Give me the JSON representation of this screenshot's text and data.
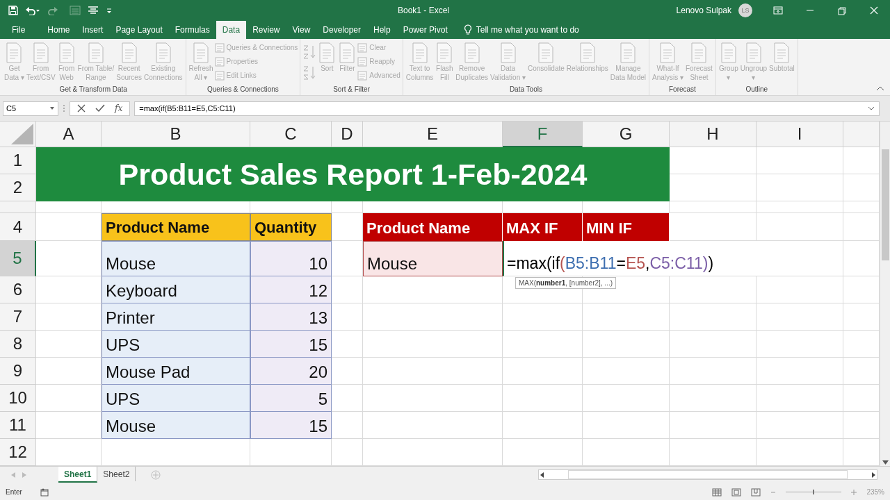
{
  "window": {
    "title": "Book1  -  Excel",
    "user": "Lenovo Sulpak",
    "avatar": "LS"
  },
  "tabs": [
    {
      "label": "File",
      "selected": false
    },
    {
      "label": "Home",
      "selected": false
    },
    {
      "label": "Insert",
      "selected": false
    },
    {
      "label": "Page Layout",
      "selected": false
    },
    {
      "label": "Formulas",
      "selected": false
    },
    {
      "label": "Data",
      "selected": true
    },
    {
      "label": "Review",
      "selected": false
    },
    {
      "label": "View",
      "selected": false
    },
    {
      "label": "Developer",
      "selected": false
    },
    {
      "label": "Help",
      "selected": false
    },
    {
      "label": "Power Pivot",
      "selected": false
    }
  ],
  "tell_me": "Tell me what you want to do",
  "ribbon": {
    "groups": [
      {
        "label": "Get & Transform Data",
        "commands": [
          {
            "kind": "large",
            "lines": [
              "Get",
              "Data ▾"
            ],
            "disabled": true
          },
          {
            "kind": "large",
            "lines": [
              "From",
              "Text/CSV"
            ],
            "disabled": true
          },
          {
            "kind": "large",
            "lines": [
              "From",
              "Web"
            ],
            "disabled": true
          },
          {
            "kind": "large",
            "lines": [
              "From Table/",
              "Range"
            ],
            "disabled": true
          },
          {
            "kind": "large",
            "lines": [
              "Recent",
              "Sources"
            ],
            "disabled": true
          },
          {
            "kind": "large",
            "lines": [
              "Existing",
              "Connections"
            ],
            "disabled": true
          }
        ]
      },
      {
        "label": "Queries & Connections",
        "commands": [
          {
            "kind": "large",
            "lines": [
              "Refresh",
              "All ▾"
            ],
            "disabled": true
          },
          {
            "kind": "small",
            "lines": [
              "Queries & Connections",
              "Properties",
              "Edit Links"
            ],
            "disabled": true
          }
        ]
      },
      {
        "label": "Sort & Filter",
        "commands": [
          {
            "kind": "sorticons",
            "disabled": true
          },
          {
            "kind": "large",
            "lines": [
              "Sort"
            ],
            "disabled": true
          },
          {
            "kind": "large",
            "lines": [
              "Filter"
            ],
            "disabled": true
          },
          {
            "kind": "small",
            "lines": [
              "Clear",
              "Reapply",
              "Advanced"
            ],
            "disabled": true
          }
        ]
      },
      {
        "label": "Data Tools",
        "commands": [
          {
            "kind": "large",
            "lines": [
              "Text to",
              "Columns"
            ],
            "disabled": true
          },
          {
            "kind": "large",
            "lines": [
              "Flash",
              "Fill"
            ],
            "disabled": true
          },
          {
            "kind": "large",
            "lines": [
              "Remove",
              "Duplicates"
            ],
            "disabled": true
          },
          {
            "kind": "large",
            "lines": [
              "Data",
              "Validation ▾"
            ],
            "disabled": true
          },
          {
            "kind": "large",
            "lines": [
              "Consolidate"
            ],
            "disabled": true
          },
          {
            "kind": "large",
            "lines": [
              "Relationships"
            ],
            "disabled": true
          },
          {
            "kind": "large",
            "lines": [
              "Manage",
              "Data Model"
            ],
            "disabled": true
          }
        ]
      },
      {
        "label": "Forecast",
        "commands": [
          {
            "kind": "large",
            "lines": [
              "What-If",
              "Analysis ▾"
            ],
            "disabled": true
          },
          {
            "kind": "large",
            "lines": [
              "Forecast",
              "Sheet"
            ],
            "disabled": true
          }
        ]
      },
      {
        "label": "Outline",
        "commands": [
          {
            "kind": "large",
            "lines": [
              "Group",
              "▾"
            ],
            "disabled": true
          },
          {
            "kind": "large",
            "lines": [
              "Ungroup",
              "▾"
            ],
            "disabled": true
          },
          {
            "kind": "large",
            "lines": [
              "Subtotal"
            ],
            "disabled": true
          }
        ]
      }
    ]
  },
  "formula_bar": {
    "name_box": "C5",
    "fx": "fx",
    "formula": "=max(if(B5:B11=E5,C5:C11)"
  },
  "columns": [
    {
      "label": "A",
      "selected": false
    },
    {
      "label": "B",
      "selected": false
    },
    {
      "label": "C",
      "selected": false
    },
    {
      "label": "D",
      "selected": false
    },
    {
      "label": "E",
      "selected": false
    },
    {
      "label": "F",
      "selected": true
    },
    {
      "label": "G",
      "selected": false
    },
    {
      "label": "H",
      "selected": false
    },
    {
      "label": "I",
      "selected": false
    }
  ],
  "rows": [
    {
      "kind": "normal",
      "label": "1",
      "selected": false
    },
    {
      "kind": "normal",
      "label": "2",
      "selected": false
    },
    {
      "kind": "short",
      "selected": false
    },
    {
      "kind": "normal",
      "label": "4",
      "selected": false
    },
    {
      "kind": "normal",
      "label": "5",
      "selected": true
    },
    {
      "kind": "normal",
      "label": "6",
      "selected": false
    },
    {
      "kind": "normal",
      "label": "7",
      "selected": false
    },
    {
      "kind": "normal",
      "label": "8",
      "selected": false
    },
    {
      "kind": "normal",
      "label": "9",
      "selected": false
    },
    {
      "kind": "normal",
      "label": "10",
      "selected": false
    },
    {
      "kind": "normal",
      "label": "11",
      "selected": false
    },
    {
      "kind": "normal",
      "label": "12",
      "selected": false
    }
  ],
  "sheet": {
    "title": "Product Sales Report 1-Feb-2024",
    "table": {
      "columns": [
        "Product Name",
        "Quantity"
      ],
      "rows": [
        [
          "Mouse",
          "10"
        ],
        [
          "Keyboard",
          "12"
        ],
        [
          "Printer",
          "13"
        ],
        [
          "UPS",
          "15"
        ],
        [
          "Mouse Pad",
          "20"
        ],
        [
          "UPS",
          "5"
        ],
        [
          "Mouse",
          "15"
        ]
      ]
    },
    "lookup": {
      "columns": [
        "Product Name",
        "MAX IF",
        "MIN IF"
      ],
      "value": "Mouse",
      "formula_parts": [
        {
          "text": "=max(if",
          "color": "#000000"
        },
        {
          "text": "(",
          "color": "#b5534f"
        },
        {
          "text": "B5:B11",
          "color": "#3e6fb0"
        },
        {
          "text": "=",
          "color": "#000000"
        },
        {
          "text": "E5",
          "color": "#b5534f"
        },
        {
          "text": ",",
          "color": "#000000"
        },
        {
          "text": "C5:C11",
          "color": "#7b5ea7"
        },
        {
          "text": ")",
          "color": "#7b5ea7"
        },
        {
          "text": ")",
          "color": "#000000"
        }
      ]
    },
    "tooltip": "MAX(**number1**, [number2], ...)"
  },
  "sheet_tabs": [
    {
      "label": "Sheet1",
      "selected": true
    },
    {
      "label": "Sheet2",
      "selected": false
    }
  ],
  "status_bar": {
    "mode": "Enter",
    "zoom_slider": {
      "level": 0.5
    },
    "zoom": "235%"
  }
}
